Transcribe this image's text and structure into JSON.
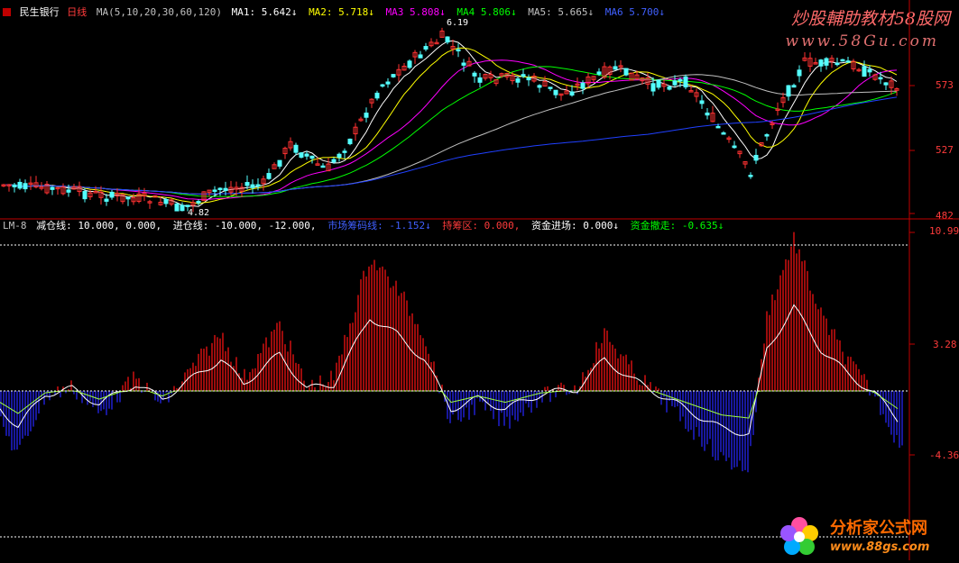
{
  "header": {
    "stock_name": "民生银行",
    "period": "日线",
    "ma_params": "MA(5,10,20,30,60,120)",
    "ma1": "MA1: 5.642↓",
    "ma2": "MA2: 5.718↓",
    "ma3": "MA3  5.808↓",
    "ma4": "MA4  5.806↓",
    "ma5": "MA5: 5.665↓",
    "ma6": "MA6  5.700↓"
  },
  "price_axis": {
    "labels": [
      "573",
      "527",
      "482"
    ]
  },
  "price_annotations": {
    "high": "6.19",
    "low": "4.82"
  },
  "indicator_header": {
    "name": "LM-8",
    "reduce_line": "减仓线: 10.000, 0.000,",
    "add_line": "进仓线: -10.000, -12.000,",
    "market_line": "市场筹码线: -1.152↓",
    "chip_zone": "持筹区: 0.000,",
    "money_in": "资金进场: 0.000↓",
    "money_out": "资金撤走: -0.635↓"
  },
  "indicator_axis": {
    "labels": [
      "10.99",
      "3.28",
      "-4.36"
    ]
  },
  "watermark": {
    "site_cn": "炒股輔助教材58股网",
    "site_url": "www.58Gu.com"
  },
  "logo": {
    "name": "分析家公式网",
    "url": "www.88gs.com"
  },
  "colors": {
    "up": "#ff3232",
    "down": "#54ffff",
    "ma1": "#ffffff",
    "ma2": "#ffff00",
    "ma3": "#ff00ff",
    "ma4": "#00ff00",
    "ma5": "#c0c0c0",
    "ma6": "#2040ff",
    "hist_up": "#d01010",
    "hist_down": "#2020d0",
    "axis": "#c00000"
  }
}
